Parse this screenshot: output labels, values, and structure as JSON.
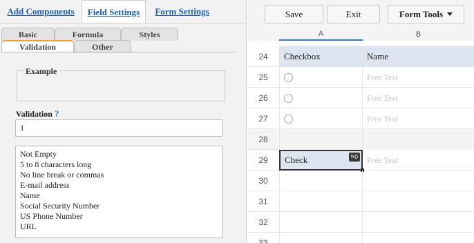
{
  "left_tabs": [
    "Add Components",
    "Field Settings",
    "Form Settings"
  ],
  "sub_tabs": {
    "basic": "Basic",
    "formula": "Formula",
    "styles": "Styles",
    "validation": "Validation",
    "other": "Other"
  },
  "example_legend": "Example",
  "validation": {
    "label": "Validation",
    "help": "?",
    "value": "1",
    "options": [
      "Not Empty",
      "5 to 8 characters long",
      "No line break or commas",
      "E-mail address",
      "Name",
      "Social Security Number",
      "US Phone Number",
      "URL"
    ]
  },
  "toolbar": {
    "save": "Save",
    "exit": "Exit",
    "form_tools": "Form Tools"
  },
  "grid": {
    "columns": [
      "A",
      "B"
    ],
    "rows": [
      {
        "num": "24",
        "a": "Checkbox",
        "b": "Name"
      },
      {
        "num": "25",
        "a": "",
        "b": "Free Text"
      },
      {
        "num": "26",
        "a": "",
        "b": "Free Text"
      },
      {
        "num": "27",
        "a": "",
        "b": "Free Text"
      },
      {
        "num": "28",
        "a": "",
        "b": ""
      },
      {
        "num": "29",
        "a": "Check",
        "b": "Free Text"
      },
      {
        "num": "30",
        "a": "",
        "b": ""
      },
      {
        "num": "31",
        "a": "",
        "b": ""
      },
      {
        "num": "32",
        "a": "",
        "b": ""
      },
      {
        "num": "33",
        "a": "",
        "b": ""
      }
    ],
    "fx_badge": "fx()"
  }
}
